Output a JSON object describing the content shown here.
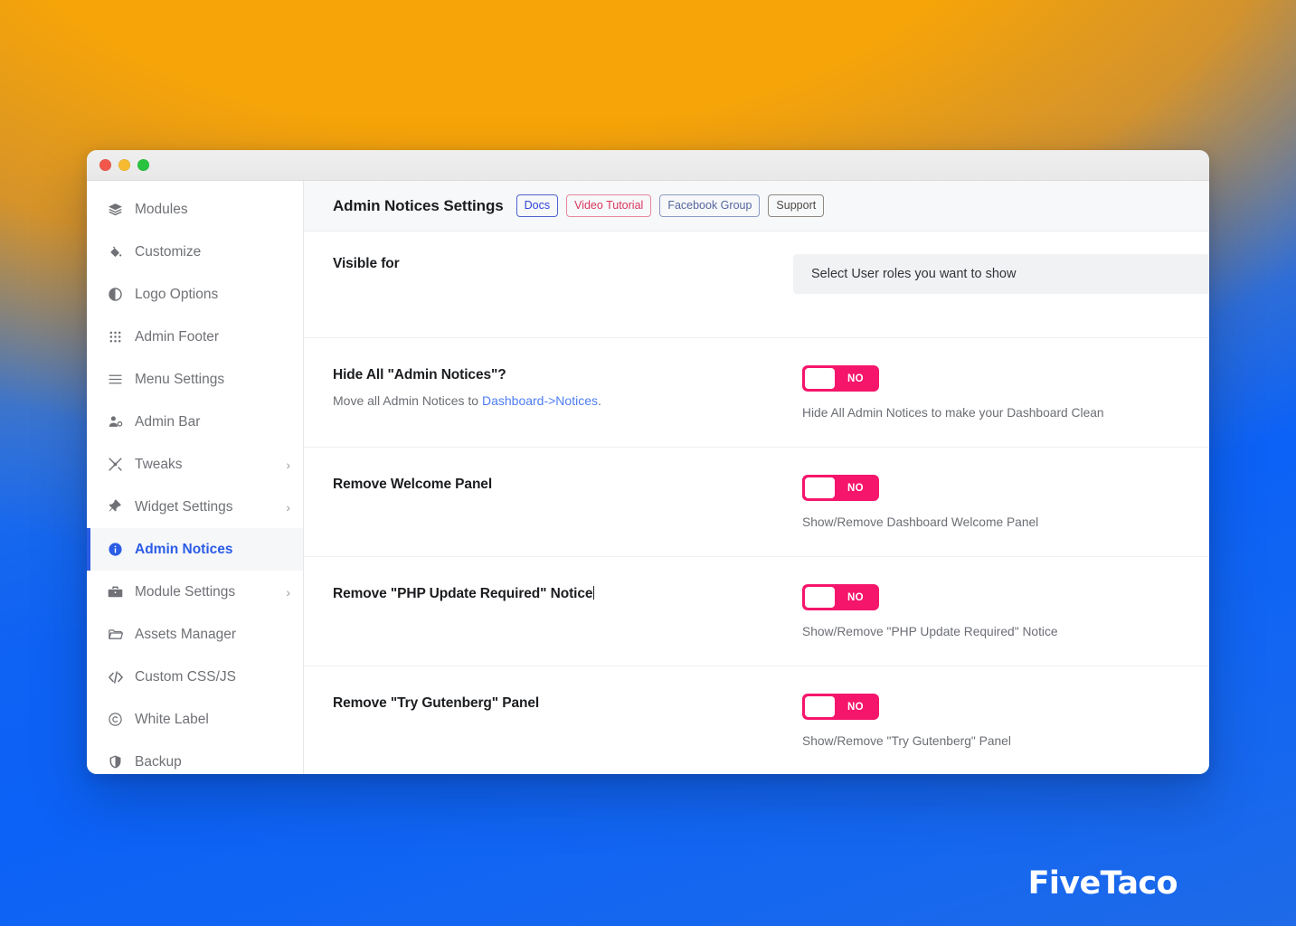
{
  "window": {
    "traffic_lights": [
      "close",
      "minimize",
      "maximize"
    ]
  },
  "sidebar": {
    "items": [
      {
        "label": "Modules",
        "icon": "layers-icon",
        "has_submenu": false,
        "active": false
      },
      {
        "label": "Customize",
        "icon": "paint-bucket-icon",
        "has_submenu": false,
        "active": false
      },
      {
        "label": "Logo Options",
        "icon": "contrast-icon",
        "has_submenu": false,
        "active": false
      },
      {
        "label": "Admin Footer",
        "icon": "grid-dots-icon",
        "has_submenu": false,
        "active": false
      },
      {
        "label": "Menu Settings",
        "icon": "hamburger-icon",
        "has_submenu": false,
        "active": false
      },
      {
        "label": "Admin Bar",
        "icon": "user-gear-icon",
        "has_submenu": false,
        "active": false
      },
      {
        "label": "Tweaks",
        "icon": "tools-icon",
        "has_submenu": true,
        "active": false
      },
      {
        "label": "Widget Settings",
        "icon": "pin-icon",
        "has_submenu": true,
        "active": false
      },
      {
        "label": "Admin Notices",
        "icon": "info-circle-icon",
        "has_submenu": false,
        "active": true
      },
      {
        "label": "Module Settings",
        "icon": "toolbox-icon",
        "has_submenu": true,
        "active": false
      },
      {
        "label": "Assets Manager",
        "icon": "folder-icon",
        "has_submenu": false,
        "active": false
      },
      {
        "label": "Custom CSS/JS",
        "icon": "code-icon",
        "has_submenu": false,
        "active": false
      },
      {
        "label": "White Label",
        "icon": "copyright-icon",
        "has_submenu": false,
        "active": false
      },
      {
        "label": "Backup",
        "icon": "shield-icon",
        "has_submenu": false,
        "active": false
      }
    ],
    "caret_glyph": "›"
  },
  "header": {
    "title": "Admin Notices Settings",
    "buttons": [
      {
        "label": "Docs",
        "color": "#2F45D6",
        "border": "#4F63D2"
      },
      {
        "label": "Video Tutorial",
        "color": "#D9375E",
        "border": "#E8879E"
      },
      {
        "label": "Facebook Group",
        "color": "#5566A0",
        "border": "#8C9AC4"
      },
      {
        "label": "Support",
        "color": "#4D4A46",
        "border": "#8D8882"
      }
    ]
  },
  "settings": {
    "visible_for": {
      "title": "Visible for",
      "select_value": "Select User roles you want to show"
    },
    "hide_all_notices": {
      "title": "Hide All \"Admin Notices\"?",
      "sub_prefix": "Move all Admin Notices to ",
      "sub_link": "Dashboard->Notices",
      "sub_suffix": ".",
      "toggle_label": "NO",
      "toggle_state": "off",
      "hint": "Hide All Admin Notices to make your Dashboard Clean"
    },
    "remove_welcome_panel": {
      "title": "Remove Welcome Panel",
      "toggle_label": "NO",
      "toggle_state": "off",
      "hint": "Show/Remove Dashboard Welcome Panel"
    },
    "remove_php_update_notice": {
      "title": "Remove \"PHP Update Required\" Notice",
      "has_text_caret": true,
      "toggle_label": "NO",
      "toggle_state": "off",
      "hint": "Show/Remove \"PHP Update Required\" Notice"
    },
    "remove_try_gutenberg_panel": {
      "title": "Remove \"Try Gutenberg\" Panel",
      "toggle_label": "NO",
      "toggle_state": "off",
      "hint": "Show/Remove \"Try Gutenberg\" Panel"
    }
  },
  "watermark": {
    "text": "FiveTaco"
  },
  "colors": {
    "accent_blue": "#2B5CE6",
    "toggle_pink": "#F5166B",
    "link_blue": "#4D7CF3",
    "background_orange": "#F6A408",
    "background_blue": "#0C62F6"
  }
}
